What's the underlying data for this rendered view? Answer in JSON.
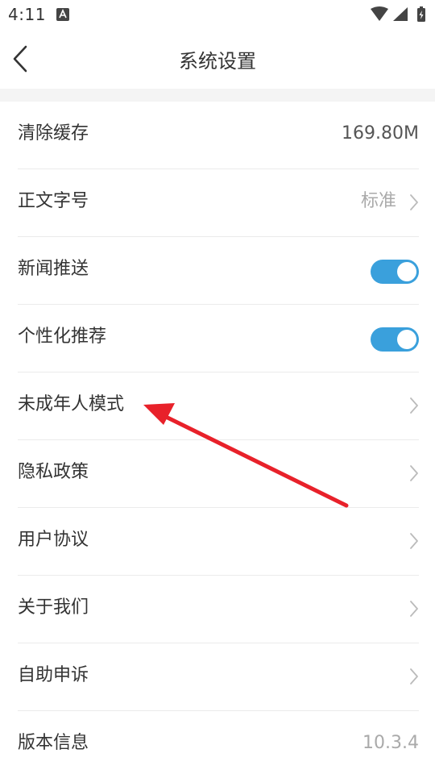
{
  "status_bar": {
    "time": "4:11",
    "notification_icon": "a-app-icon",
    "wifi_icon": "wifi-icon",
    "signal_icon": "signal-icon",
    "battery_icon": "battery-charging-icon"
  },
  "header": {
    "title": "系统设置",
    "back_icon": "chevron-left-icon"
  },
  "settings": {
    "items": [
      {
        "label": "清除缓存",
        "value": "169.80M"
      },
      {
        "label": "正文字号",
        "value": "标准"
      },
      {
        "label": "新闻推送"
      },
      {
        "label": "个性化推荐"
      },
      {
        "label": "未成年人模式"
      },
      {
        "label": "隐私政策"
      },
      {
        "label": "用户协议"
      },
      {
        "label": "关于我们"
      },
      {
        "label": "自助申诉"
      },
      {
        "label": "版本信息",
        "value": "10.3.4"
      }
    ]
  },
  "colors": {
    "toggle_on": "#3aa0dc",
    "annotation_arrow": "#e8212a",
    "separator": "#f4f4f4"
  }
}
